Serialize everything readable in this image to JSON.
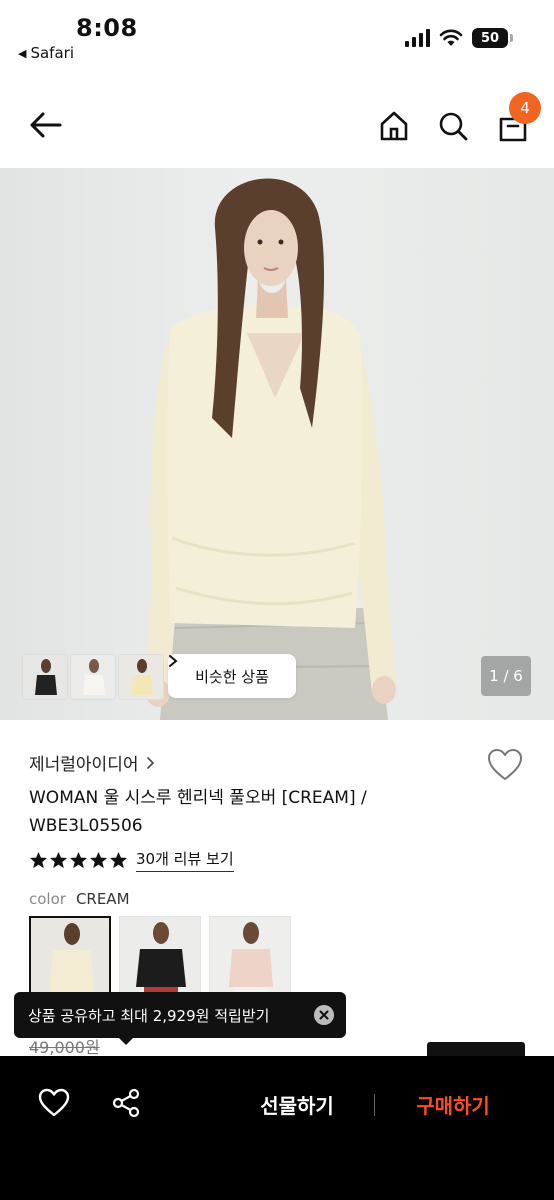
{
  "status_bar": {
    "time": "8:08",
    "back_app": "Safari",
    "battery": "50"
  },
  "nav": {
    "cart_count": "4",
    "accent_color": "#f26422"
  },
  "gallery": {
    "similar_products_label": "비슷한 상품",
    "page_indicator": "1 / 6"
  },
  "product": {
    "brand": "제너럴아이디어",
    "title": "WOMAN 울 시스루 헨리넥 풀오버 [CREAM] / WBE3L05506",
    "rating_stars": 5,
    "review_link": "30개 리뷰 보기",
    "color_label": "color",
    "color_value": "CREAM",
    "original_price": "49,000원"
  },
  "toast": {
    "message": "상품 공유하고 최대 2,929원 적립받기"
  },
  "bottom_bar": {
    "gift_label": "선물하기",
    "buy_label": "구매하기",
    "buy_color": "#ff4d1f"
  }
}
